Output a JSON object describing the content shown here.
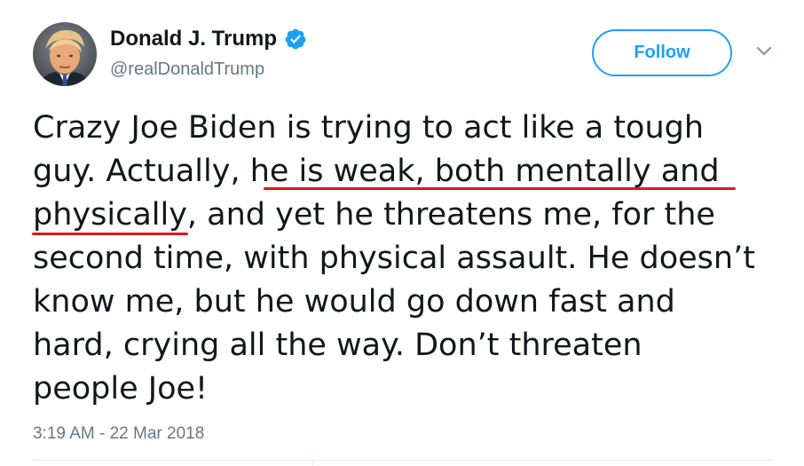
{
  "author": {
    "display_name": "Donald J. Trump",
    "handle": "@realDonaldTrump",
    "verified": true,
    "avatar_icon": "profile-photo"
  },
  "actions": {
    "follow_label": "Follow",
    "menu_icon": "chevron-down-icon"
  },
  "tweet": {
    "lines": [
      "Crazy Joe Biden is trying to act like a tough",
      "guy. Actually, he is weak, both mentally and",
      "physically, and yet he threatens me, for the",
      "second time, with physical assault. He doesn’t",
      "know me, but he would go down fast and",
      "hard, crying all the way. Don’t threaten",
      "people Joe!"
    ],
    "timestamp": "3:19 AM - 22 Mar 2018"
  },
  "colors": {
    "accent": "#1da1f2",
    "text": "#14171a",
    "secondary_text": "#657786",
    "annotation_underline": "#e0141e"
  }
}
